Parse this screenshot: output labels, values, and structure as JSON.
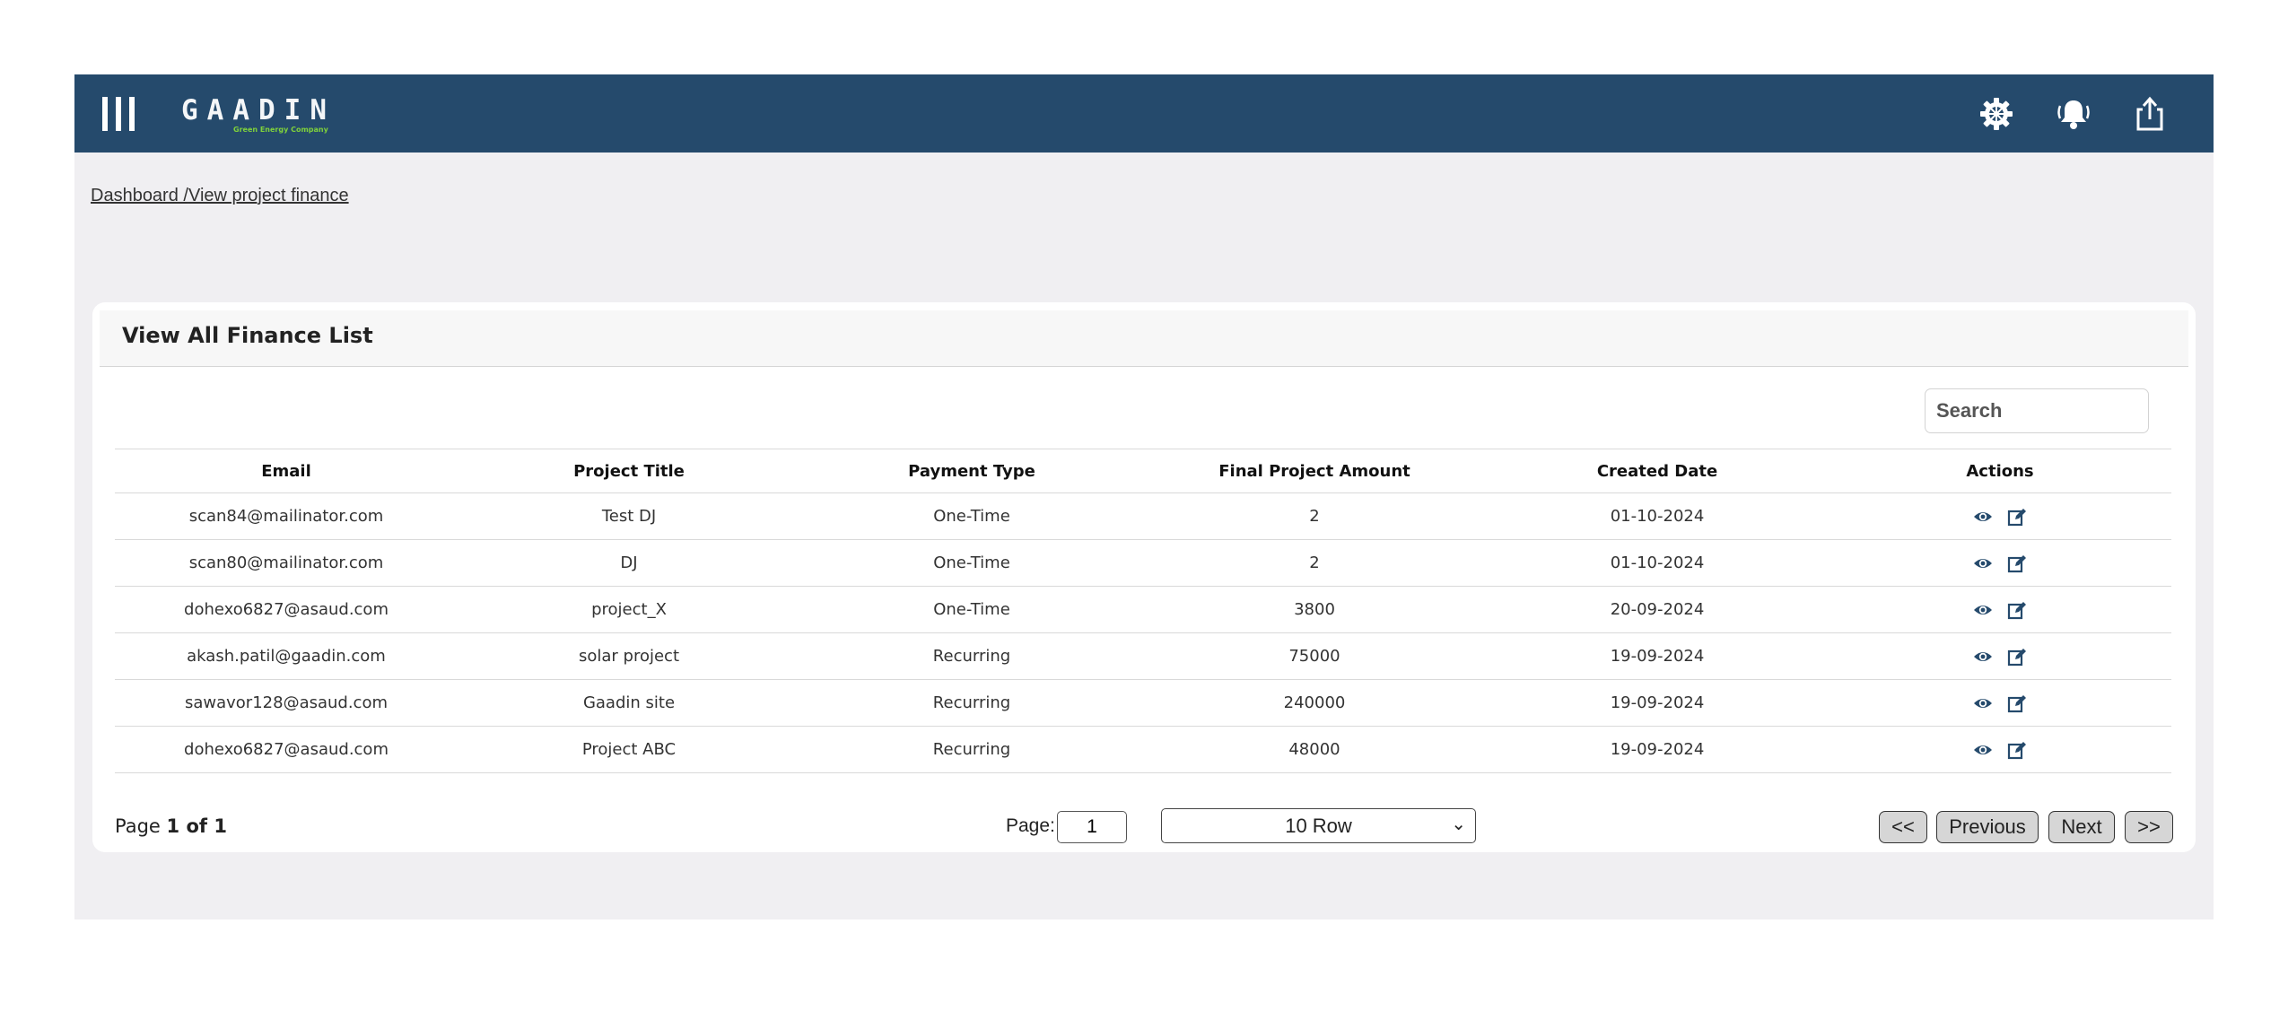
{
  "header": {
    "logo_text": "GAADIN",
    "logo_tagline": "Green Energy Company",
    "icons": [
      "menu-icon",
      "settings-icon",
      "bell-icon",
      "share-icon"
    ]
  },
  "breadcrumb": {
    "home": "Dashboard /",
    "current": "View project finance"
  },
  "card": {
    "title": "View All Finance List",
    "search_placeholder": "Search"
  },
  "table": {
    "columns": [
      "Email",
      "Project Title",
      "Payment Type",
      "Final Project Amount",
      "Created Date",
      "Actions"
    ],
    "rows": [
      [
        "scan84@mailinator.com",
        "Test DJ",
        "One-Time",
        "2",
        "01-10-2024"
      ],
      [
        "scan80@mailinator.com",
        "DJ",
        "One-Time",
        "2",
        "01-10-2024"
      ],
      [
        "dohexo6827@asaud.com",
        "project_X",
        "One-Time",
        "3800",
        "20-09-2024"
      ],
      [
        "akash.patil@gaadin.com",
        "solar project",
        "Recurring",
        "75000",
        "19-09-2024"
      ],
      [
        "sawavor128@asaud.com",
        "Gaadin site",
        "Recurring",
        "240000",
        "19-09-2024"
      ],
      [
        "dohexo6827@asaud.com",
        "Project ABC",
        "Recurring",
        "48000",
        "19-09-2024"
      ]
    ],
    "row_actions": [
      "view-icon",
      "edit-icon"
    ]
  },
  "pagination": {
    "page_prefix": "Page ",
    "page_of": "1 of 1",
    "page_label": "Page:",
    "page_value": "1",
    "rows_selected": "10 Row",
    "first": "<<",
    "previous": "Previous",
    "next": "Next",
    "last": ">>"
  },
  "colors": {
    "topbar": "#254a6c",
    "background": "#f0eff2",
    "logo_tagline": "#7fd13b"
  }
}
